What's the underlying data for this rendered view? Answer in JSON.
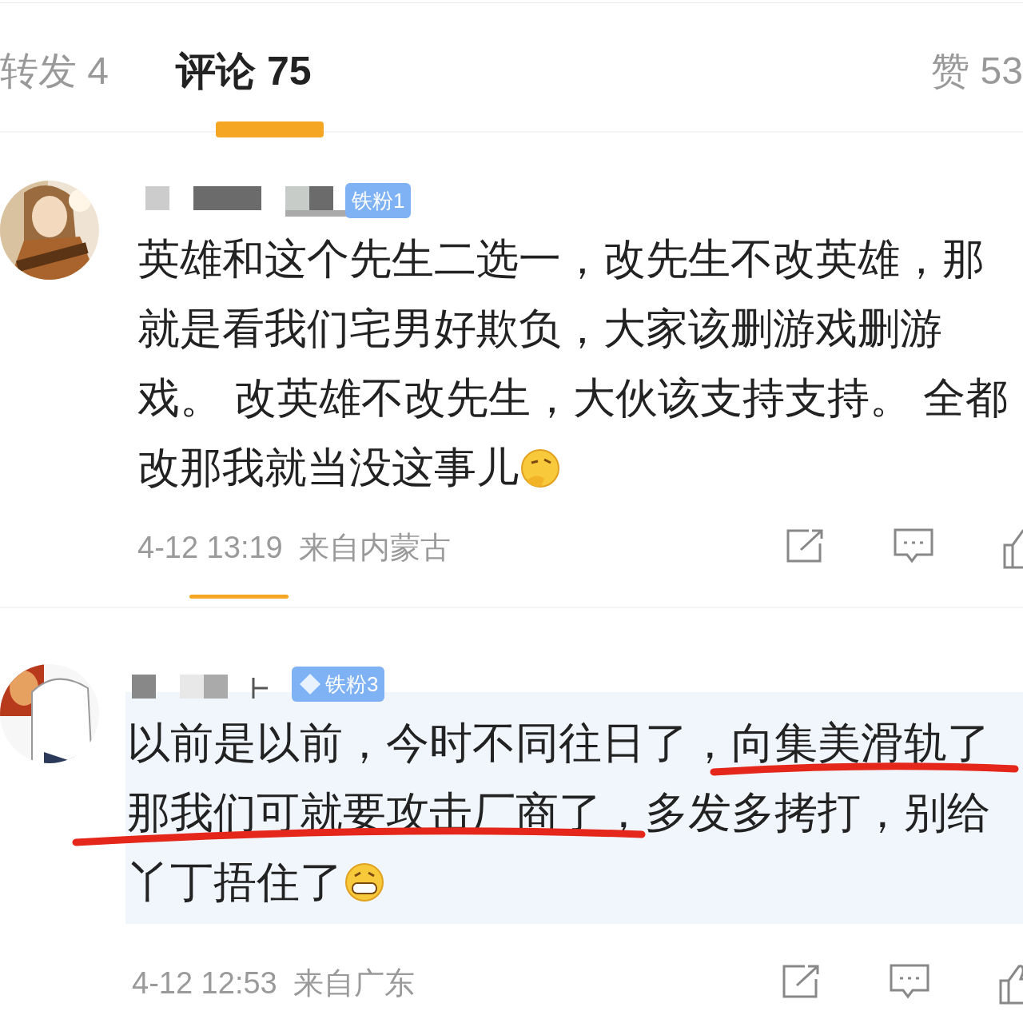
{
  "tabs": [
    {
      "label": "转发 4",
      "selected": false
    },
    {
      "label": "评论 75",
      "selected": true
    },
    {
      "label": "赞 53",
      "selected": false
    }
  ],
  "comments": [
    {
      "kind": "thinking",
      "badge": "铁粉1",
      "badge_icon": false,
      "lines": [
        "英雄和这个先生二选一，改先生不改英雄，那",
        "就是看我们宅男好欺负，大家该删游戏删游",
        "戏。 改英雄不改先生，大伙该支持支持。 全都",
        "改那我就当没这事儿"
      ],
      "time": "4-12 13:19",
      "location": "来自内蒙古",
      "highlighted": false,
      "red_underline": false
    },
    {
      "kind": "grin",
      "badge": "铁粉3",
      "badge_icon": true,
      "lines": [
        "以前是以前，今时不同往日了，向集美滑轨了",
        "那我们可就要攻击厂商了，多发多拷打，别给",
        "丫丁捂住了"
      ],
      "time": "4-12 12:53",
      "location": "来自广东",
      "highlighted": true,
      "red_underline": true
    }
  ]
}
